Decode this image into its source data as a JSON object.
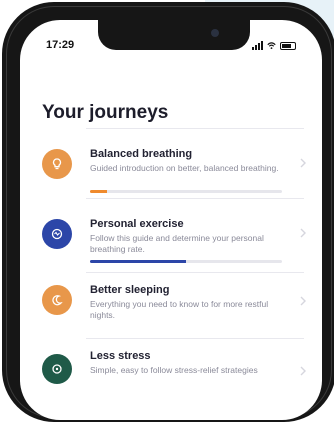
{
  "status_bar": {
    "time": "17:29"
  },
  "page": {
    "title": "Your journeys"
  },
  "journeys": [
    {
      "title": "Balanced breathing",
      "description": "Guided introduction on better, balanced breathing.",
      "icon": "bulb-icon",
      "color": "#e8974a",
      "progress": 0.09,
      "progress_color": "#ef8a2d"
    },
    {
      "title": "Personal exercise",
      "description": "Follow this guide and determine your personal breathing rate.",
      "icon": "breath-cycle-icon",
      "color": "#2c46a8",
      "progress": 0.5,
      "progress_color": "#2c46a8"
    },
    {
      "title": "Better sleeping",
      "description": "Everything you need to know to for more restful nights.",
      "icon": "moon-icon",
      "color": "#e8974a",
      "progress": null
    },
    {
      "title": "Less stress",
      "description": "Simple, easy to follow stress-relief strategies",
      "icon": "calm-icon",
      "color": "#1f5a48",
      "progress": null
    }
  ]
}
